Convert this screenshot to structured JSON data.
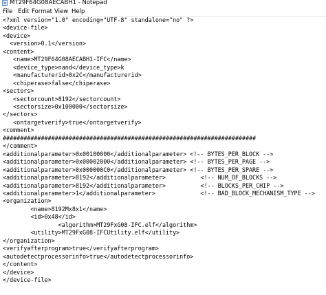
{
  "window": {
    "title": "MT29F64G08AECABH1 - Notepad"
  },
  "menu": {
    "file": "File",
    "edit": "Edit",
    "format": "Format",
    "view": "View",
    "help": "Help"
  },
  "editor": {
    "content": "<?xml version=\"1.0\" encoding=\"UTF-8\" standalone=\"no\" ?>\n<device-file>\n<device>\n  <version>0.1</version>\n<content>\n   <name>MT29F64G08AECABH1-IFC</name>\n   <device_type>nand</device_type>k\n   <manufacturerid>0x2C</manufacturerid>\n   <chiperase>false</chiperase>\n<sectors>\n   <sectorcount>8192</sectorcount>\n   <sectorsize>0x100000</sectorsize>\n</sectors>\n   <ontargetverify>true</ontargetverify>\n<comment>\n#########################################################################\n</comment>\n<additionalparameter>0x00100000</additionalparameter> <!-- BYTES_PER_BLOCK -->\n<additionalparameter>0x00002000</additionalparameter> <!-- BYTES_PER_PAGE -->\n<additionalparameter>0x000000C0</additionalparameter> <!-- BYTES_PER_SPARE -->\n<additionalparameter>8192</additionalparameter>          <!-- NUM_OF_BLOCKS -->\n<additionalparameter>8192</additionalparameter>          <!-- BLOCKS_PER_CHIP -->\n<additionalparameter>1</additionalparameter>             <!-- BAD_BLOCK_MECHANISM_TYPE -->\n<organization>\n        <name>8192Mx8x1</name>\n        <id>0x48</id>\n                <algorithm>MT29FxG08-IFC.elf</algorithm>\n        <utility>MT29FxG08-IFCUtility.elf</utility>\n</organization>\n<verifyafterprogram>true</verifyafterprogram>\n<autodetectprocessorinfo>true</autodetectprocessorinfo>\n</content>\n</device>\n</device-file>"
  }
}
